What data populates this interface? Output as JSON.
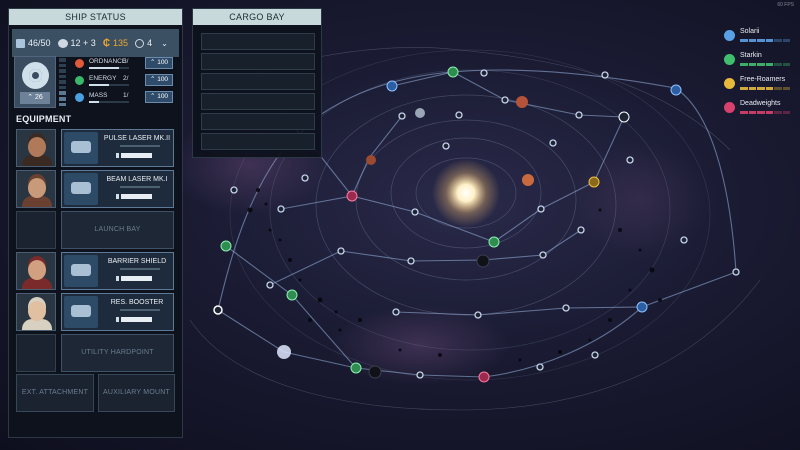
{
  "hud": {
    "fps": "60 FPS"
  },
  "ship_status": {
    "title": "SHIP STATUS",
    "cargo": "46/50",
    "crew": "12 + 3",
    "credits": "135",
    "fuel": "4",
    "reactor_level": "26",
    "reactor_meter_fraction": 0.33,
    "resources": [
      {
        "name": "ORDNANCE",
        "used": "3/",
        "value": "100",
        "color": "#e05a3a",
        "fill": 0.75
      },
      {
        "name": "ENERGY",
        "used": "2/",
        "value": "100",
        "color": "#3ab86a",
        "fill": 0.5
      },
      {
        "name": "MASS",
        "used": "1/",
        "value": "100",
        "color": "#4aa0e0",
        "fill": 0.25
      }
    ]
  },
  "equipment": {
    "title": "EQUIPMENT",
    "slots": [
      {
        "name": "PULSE LASER MK.II",
        "filled": true,
        "crew": true
      },
      {
        "name": "BEAM LASER MK.I",
        "filled": true,
        "crew": true
      },
      {
        "name": "LAUNCH BAY",
        "filled": false,
        "crew": false
      },
      {
        "name": "BARRIER SHIELD",
        "filled": true,
        "crew": true
      },
      {
        "name": "RES. BOOSTER",
        "filled": true,
        "crew": true
      },
      {
        "name": "UTILITY HARDPOINT",
        "filled": false,
        "crew": false
      }
    ],
    "mounts": [
      "EXT. ATTACHMENT",
      "AUXILIARY MOUNT"
    ]
  },
  "cargo_bay": {
    "title": "CARGO BAY",
    "slot_count": 6
  },
  "legend": [
    {
      "name": "Solarii",
      "color": "#5aa0e6",
      "icon": "solarii-faction-icon"
    },
    {
      "name": "Starkin",
      "color": "#3fbf6e",
      "icon": "starkin-faction-icon"
    },
    {
      "name": "Free-Roamers",
      "color": "#e6b93a",
      "icon": "free-roamers-faction-icon"
    },
    {
      "name": "Deadweights",
      "color": "#d8416e",
      "icon": "deadweights-faction-icon"
    }
  ],
  "colors": {
    "panel_header": "#c7d9da",
    "panel_bg": "#0e121c",
    "accent_blue": "#2e4b6a",
    "star": "#fff4d6"
  }
}
